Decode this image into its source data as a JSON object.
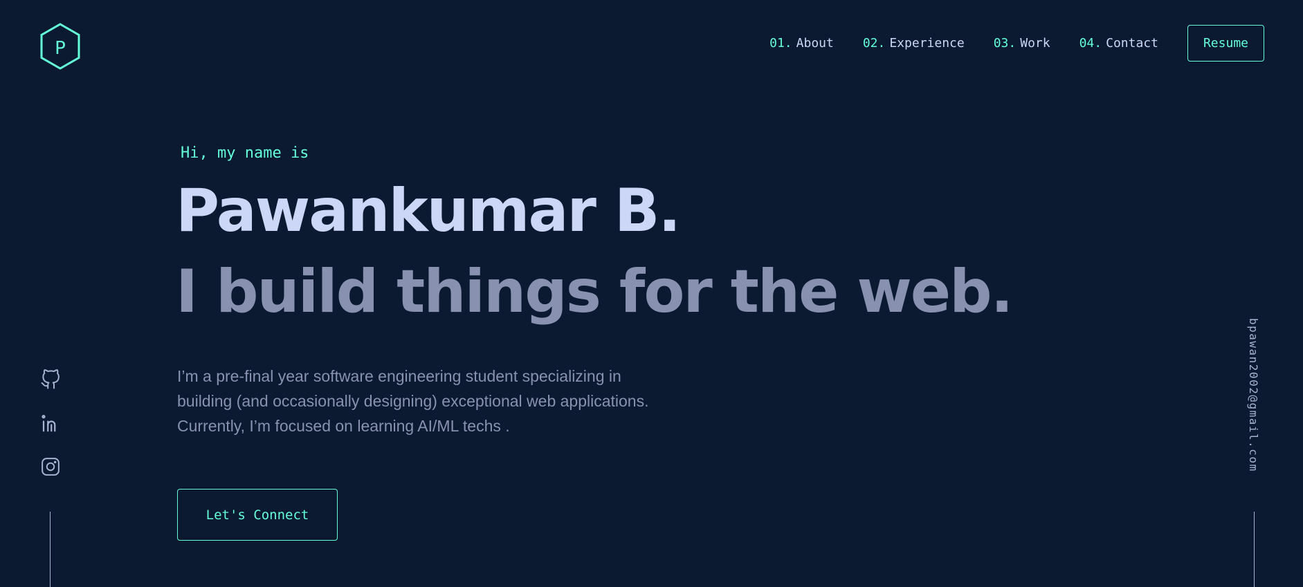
{
  "logo": {
    "letter": "P",
    "icon": "hexagon-logo-icon"
  },
  "nav": {
    "items": [
      {
        "number": "01.",
        "label": "About"
      },
      {
        "number": "02.",
        "label": "Experience"
      },
      {
        "number": "03.",
        "label": "Work"
      },
      {
        "number": "04.",
        "label": "Contact"
      }
    ],
    "resume_label": "Resume"
  },
  "hero": {
    "greeting": "Hi, my name is",
    "name": "Pawankumar B.",
    "tagline": "I build things for the web.",
    "bio_lines": [
      "I’m a pre-final year software engineering student specializing in",
      "building (and occasionally designing) exceptional web applications.",
      "Currently, I’m focused on learning AI/ML techs ."
    ],
    "cta_label": "Let's Connect"
  },
  "socials": [
    {
      "icon": "github-icon"
    },
    {
      "icon": "linkedin-icon"
    },
    {
      "icon": "instagram-icon"
    }
  ],
  "email": "bpawan2002@gmail.com",
  "colors": {
    "background": "#0b1a31",
    "accent": "#64ffda",
    "heading": "#ccd6f6",
    "text": "#8892b0",
    "light_text": "#a8b2d1"
  }
}
